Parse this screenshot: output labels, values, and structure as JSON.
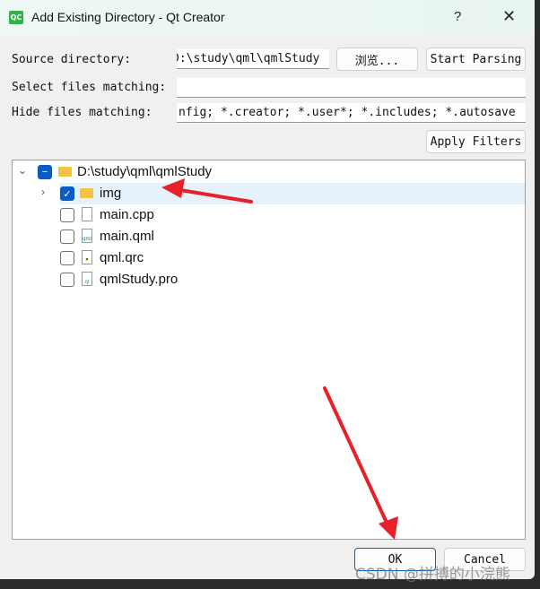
{
  "window": {
    "title": "Add Existing Directory - Qt Creator",
    "app_icon": "QC",
    "help": "?",
    "close": "✕"
  },
  "form": {
    "source_label": "Source directory:",
    "source_value": "D:\\study\\qml\\qmlStudy",
    "browse_label": "浏览...",
    "start_parsing_label": "Start Parsing",
    "select_label": "Select files matching:",
    "select_value": "",
    "hide_label": "Hide files matching:",
    "hide_value": "nfig; *.creator; *.user*; *.includes; *.autosave",
    "apply_label": "Apply Filters"
  },
  "tree": {
    "root": {
      "label": "D:\\study\\qml\\qmlStudy",
      "state": "partial"
    },
    "items": [
      {
        "label": "img",
        "type": "folder",
        "checked": true
      },
      {
        "label": "main.cpp",
        "type": "file",
        "checked": false
      },
      {
        "label": "main.qml",
        "type": "qml-file",
        "checked": false
      },
      {
        "label": "qml.qrc",
        "type": "qrc-file",
        "checked": false
      },
      {
        "label": "qmlStudy.pro",
        "type": "pro-file",
        "checked": false
      }
    ]
  },
  "buttons": {
    "ok": "OK",
    "cancel": "Cancel"
  },
  "watermark": "CSDN @拼搏的小浣熊",
  "colors": {
    "annotation": "#e8202a",
    "accent": "#0a5bc4"
  }
}
